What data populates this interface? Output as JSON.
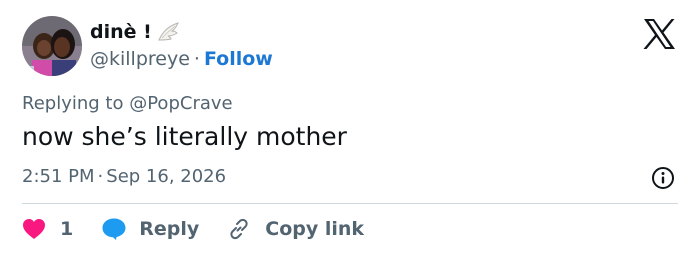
{
  "author": {
    "display_name": "dinè !",
    "avatar": "avatar-photo",
    "wing_icon": "wing-emoji-icon",
    "handle": "@killpreye",
    "separator": "·",
    "follow_label": "Follow"
  },
  "platform_icon": "x-logo-icon",
  "reply_context": {
    "prefix": "Replying to",
    "mention": "@PopCrave"
  },
  "tweet": {
    "text": "now she’s literally mother",
    "time": "2:51 PM",
    "separator": "·",
    "date": "Sep 16, 2026",
    "info_icon": "info-icon"
  },
  "actions": {
    "like_count": "1",
    "reply_label": "Reply",
    "copy_label": "Copy link"
  },
  "colors": {
    "heart": "#f91880",
    "reply_bubble": "#1d9bf0",
    "follow": "#1d78d4",
    "text_primary": "#0f1419",
    "text_secondary": "#536471"
  }
}
